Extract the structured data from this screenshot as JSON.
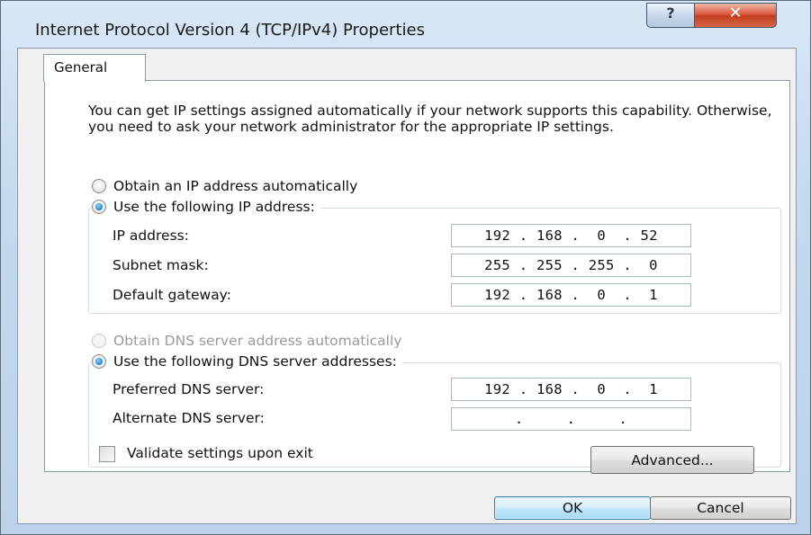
{
  "window": {
    "title": "Internet Protocol Version 4 (TCP/IPv4) Properties",
    "help_glyph": "?",
    "close_glyph": "✕"
  },
  "tabs": [
    {
      "label": "General",
      "selected": true
    }
  ],
  "description": "You can get IP settings assigned automatically if your network supports this capability. Otherwise, you need to ask your network administrator for the appropriate IP settings.",
  "ip_section": {
    "auto_option": {
      "label": "Obtain an IP address automatically",
      "selected": false
    },
    "manual_option": {
      "label": "Use the following IP address:",
      "selected": true
    },
    "fields": [
      {
        "label": "IP address:",
        "value": "192 . 168 .  0  . 52"
      },
      {
        "label": "Subnet mask:",
        "value": "255 . 255 . 255 .  0"
      },
      {
        "label": "Default gateway:",
        "value": "192 . 168 .  0  .  1"
      }
    ]
  },
  "dns_section": {
    "auto_option": {
      "label": "Obtain DNS server address automatically",
      "selected": false,
      "disabled": true
    },
    "manual_option": {
      "label": "Use the following DNS server addresses:",
      "selected": true
    },
    "fields": [
      {
        "label": "Preferred DNS server:",
        "value": "192 . 168 .  0  .  1"
      },
      {
        "label": "Alternate DNS server:",
        "value": "   .     .     .   "
      }
    ]
  },
  "validate": {
    "label": "Validate settings upon exit",
    "checked": false
  },
  "buttons": {
    "advanced": "Advanced...",
    "ok": "OK",
    "cancel": "Cancel"
  },
  "colors": {
    "title_bar": "#c4d9ee",
    "close_button": "#d9553c",
    "ok_button": "#bee6fd",
    "radio_selected": "#0b63b5"
  }
}
